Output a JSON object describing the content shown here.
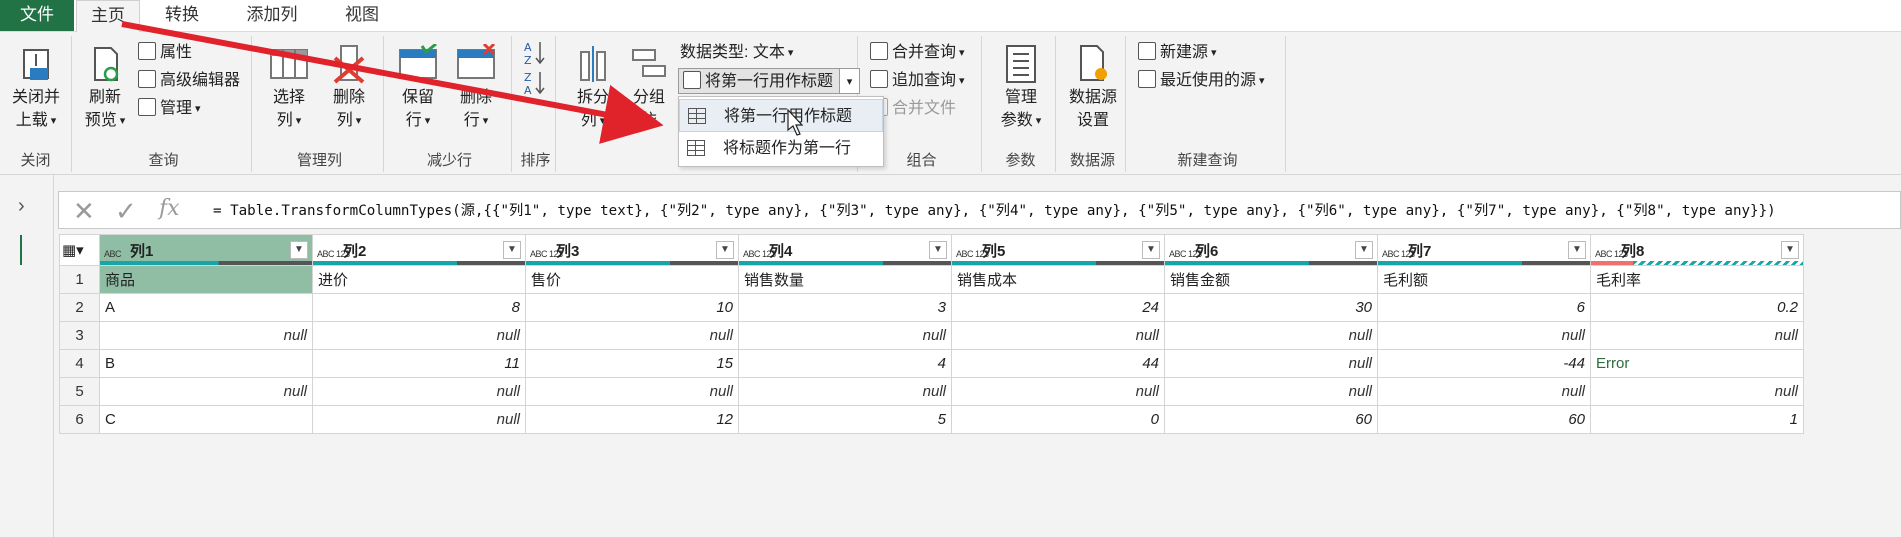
{
  "tabs": [
    "文件",
    "主页",
    "转换",
    "添加列",
    "视图"
  ],
  "ribbon": {
    "close": {
      "l1": "关闭并",
      "l2": "上载",
      "group": "关闭"
    },
    "query": {
      "refresh1": "刷新",
      "refresh2": "预览",
      "properties": "属性",
      "advanced_editor": "高级编辑器",
      "manage": "管理",
      "group": "查询"
    },
    "manage_cols": {
      "choose1": "选择",
      "choose2": "列",
      "remove1": "删除",
      "remove2": "列",
      "group": "管理列"
    },
    "reduce_rows": {
      "keep1": "保留",
      "keep2": "行",
      "remove1": "删除",
      "remove2": "行",
      "group": "减少行"
    },
    "sort": {
      "group": "排序"
    },
    "transform": {
      "split1": "拆分",
      "split2": "列",
      "group_by1": "分组",
      "group_by2": "依",
      "data_type": "数据类型: 文本",
      "first_row_header": "将第一行用作标题"
    },
    "combine": {
      "merge": "合并查询",
      "append": "追加查询",
      "combine_files": "合并文件",
      "group": "组合"
    },
    "params": {
      "l1": "管理",
      "l2": "参数",
      "group": "参数"
    },
    "datasource": {
      "l1": "数据源",
      "l2": "设置",
      "group": "数据源"
    },
    "newquery": {
      "new_source": "新建源",
      "recent": "最近使用的源",
      "group": "新建查询"
    }
  },
  "dropdown": {
    "item1": "将第一行用作标题",
    "item2": "将标题作为第一行"
  },
  "formula": {
    "fx": "fx",
    "text": "= Table.TransformColumnTypes(源,{{\"列1\", type text}, {\"列2\", type any}, {\"列3\", type any}, {\"列4\", type any}, {\"列5\", type any}, {\"列6\", type any}, {\"列7\", type any}, {\"列8\", type any}})"
  },
  "grid": {
    "columns": [
      {
        "type": "ABC",
        "name": "列1"
      },
      {
        "type": "ABC 123",
        "name": "列2"
      },
      {
        "type": "ABC 123",
        "name": "列3"
      },
      {
        "type": "ABC 123",
        "name": "列4"
      },
      {
        "type": "ABC 123",
        "name": "列5"
      },
      {
        "type": "ABC 123",
        "name": "列6"
      },
      {
        "type": "ABC 123",
        "name": "列7"
      },
      {
        "type": "ABC 123",
        "name": "列8"
      }
    ],
    "rows": [
      [
        "商品",
        "进价",
        "售价",
        "销售数量",
        "销售成本",
        "销售金额",
        "毛利额",
        "毛利率"
      ],
      [
        "A",
        "8",
        "10",
        "3",
        "24",
        "30",
        "6",
        "0.2"
      ],
      [
        "null",
        "null",
        "null",
        "null",
        "null",
        "null",
        "null",
        "null"
      ],
      [
        "B",
        "11",
        "15",
        "4",
        "44",
        "null",
        "-44",
        "Error"
      ],
      [
        "null",
        "null",
        "null",
        "null",
        "null",
        "null",
        "null",
        "null"
      ],
      [
        "C",
        "null",
        "12",
        "5",
        "0",
        "60",
        "60",
        "1"
      ]
    ]
  },
  "colors": {
    "file_tab": "#217346",
    "selected_col": "#8fbea4",
    "arrow": "#e0222b",
    "quality": "#17a5a7"
  }
}
